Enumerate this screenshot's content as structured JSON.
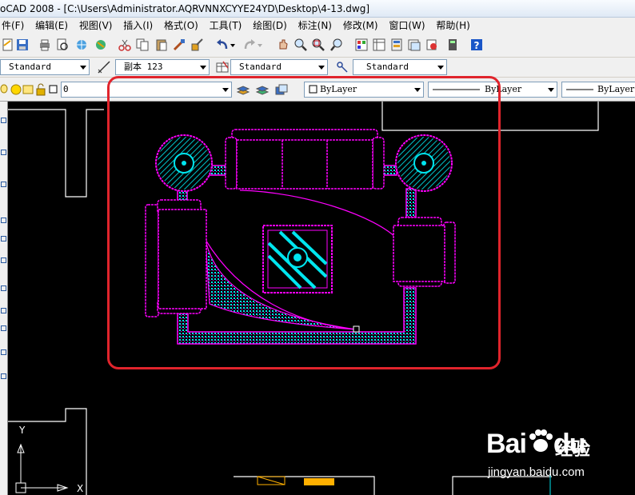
{
  "window": {
    "title": "oCAD 2008 - [C:\\Users\\Administrator.AQRVNNXCYYE24YD\\Desktop\\4-13.dwg]"
  },
  "menu": {
    "items": [
      "件(F)",
      "编辑(E)",
      "视图(V)",
      "插入(I)",
      "格式(O)",
      "工具(T)",
      "绘图(D)",
      "标注(N)",
      "修改(M)",
      "窗口(W)",
      "帮助(H)"
    ]
  },
  "styles_toolbar": {
    "text_style": "Standard",
    "dim_style": "副本 123",
    "table_style": "Standard",
    "multileader_style": "Standard"
  },
  "layers_toolbar": {
    "current_layer": "0"
  },
  "properties_toolbar": {
    "color": "ByLayer",
    "linetype": "ByLayer",
    "lineweight": "ByLayer"
  },
  "canvas": {
    "background": "#000000",
    "furniture_color": "#ff00ff",
    "hatch_color": "#00e5ee",
    "wall_color": "#ffffff",
    "ucs_y": "Y",
    "ucs_x": "X"
  },
  "annotation": {
    "color": "#e0242c"
  },
  "watermark": {
    "brand_left": "Bai",
    "brand_right": "du",
    "brand_cn": "经验",
    "url": "jingyan.baidu.com"
  }
}
